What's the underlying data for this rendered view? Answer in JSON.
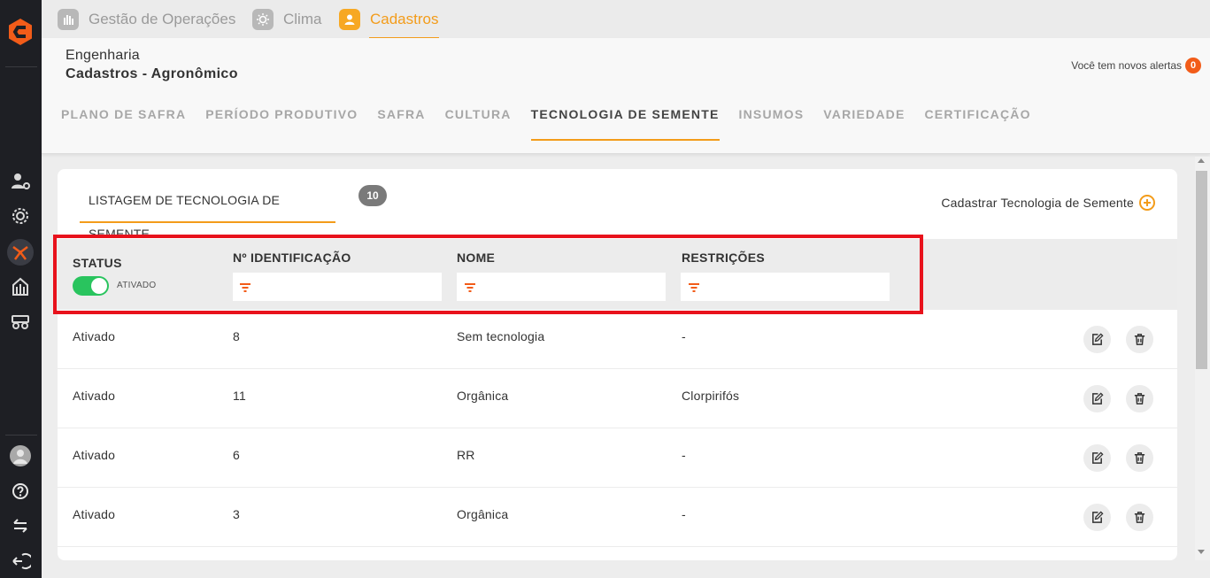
{
  "app_tabs": [
    {
      "label": "Gestão de Operações",
      "icon": "hand-icon"
    },
    {
      "label": "Clima",
      "icon": "sun-icon"
    },
    {
      "label": "Cadastros",
      "icon": "user-icon"
    }
  ],
  "header": {
    "breadcrumb_parent": "Engenharia",
    "breadcrumb_current": "Cadastros - Agronômico",
    "alerts_text": "Você tem novos alertas",
    "alerts_count": "0"
  },
  "sub_tabs": [
    "PLANO DE SAFRA",
    "PERÍODO PRODUTIVO",
    "SAFRA",
    "CULTURA",
    "TECNOLOGIA DE SEMENTE",
    "INSUMOS",
    "VARIEDADE",
    "CERTIFICAÇÃO"
  ],
  "active_sub_tab": "TECNOLOGIA DE SEMENTE",
  "list": {
    "title": "LISTAGEM DE TECNOLOGIA DE SEMENTE",
    "count": "10",
    "add_label": "Cadastrar Tecnologia de Semente"
  },
  "columns": {
    "status": "STATUS",
    "id": "Nº IDENTIFICAÇÃO",
    "name": "NOME",
    "restrictions": "RESTRIÇÕES"
  },
  "status_filter": {
    "label": "ATIVADO",
    "on": true
  },
  "filters": {
    "id": "",
    "name": "",
    "restrictions": ""
  },
  "rows": [
    {
      "status": "Ativado",
      "id": "8",
      "name": "Sem tecnologia",
      "restrictions": "-"
    },
    {
      "status": "Ativado",
      "id": "11",
      "name": "Orgânica",
      "restrictions": "Clorpirifós"
    },
    {
      "status": "Ativado",
      "id": "6",
      "name": "RR",
      "restrictions": "-"
    },
    {
      "status": "Ativado",
      "id": "3",
      "name": "Orgânica",
      "restrictions": "-"
    }
  ],
  "colors": {
    "accent": "#f39c1a",
    "toggle_on": "#29c45e",
    "highlight": "#e8121c",
    "sidebar": "#1e1f24"
  }
}
